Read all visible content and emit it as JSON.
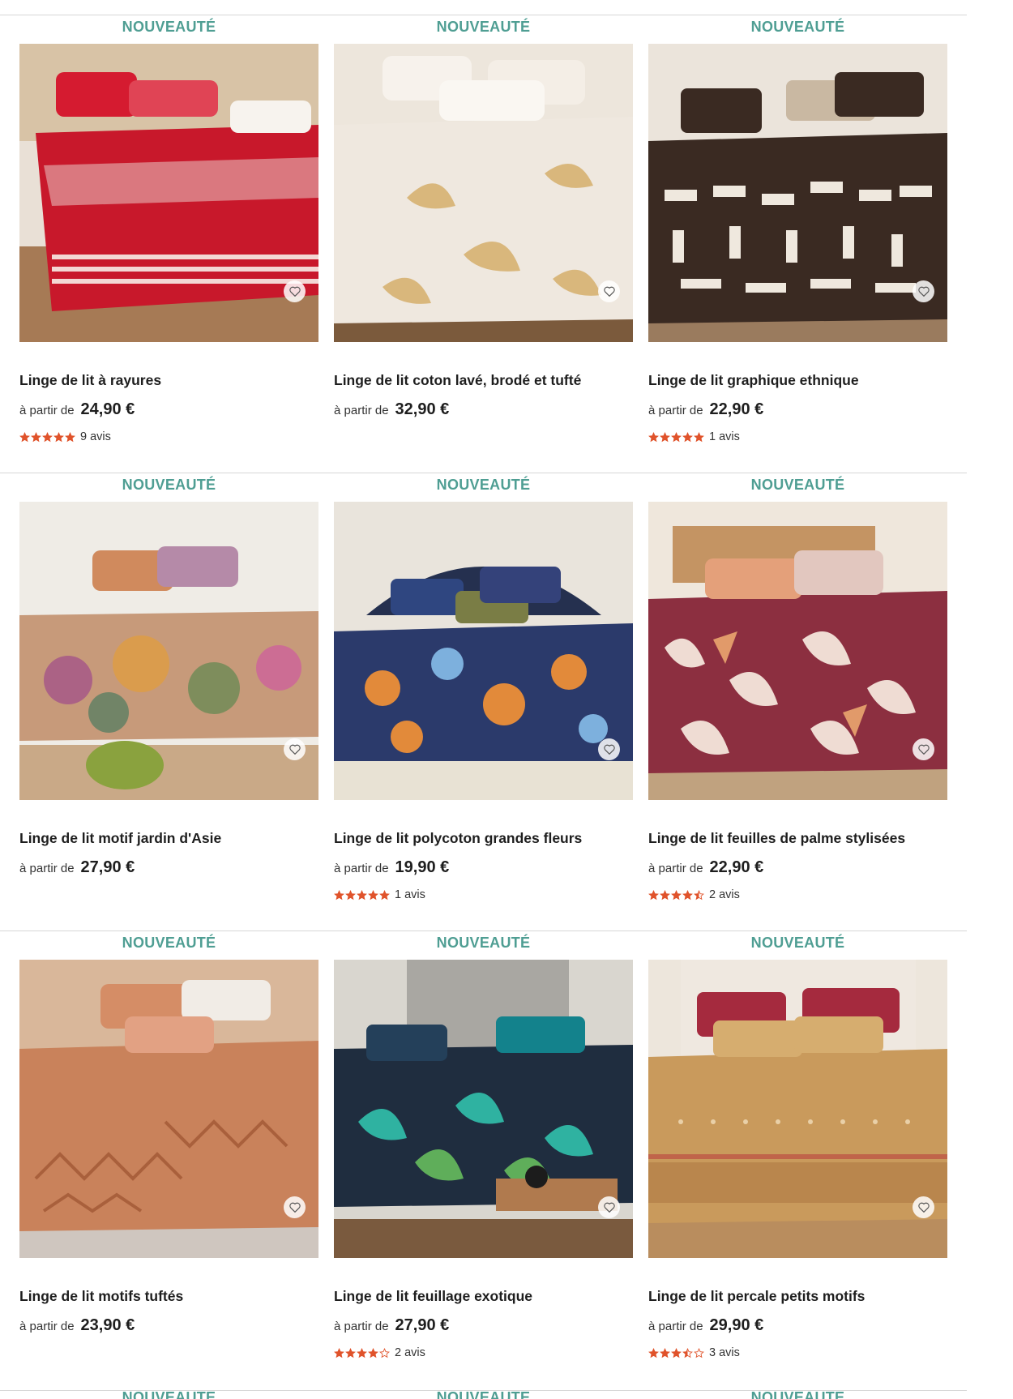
{
  "badge_text": "NOUVEAUTÉ",
  "colors": {
    "badge": "#4f9e93",
    "star": "#e0532b"
  },
  "products": [
    {
      "title": "Linge de lit à rayures",
      "from_label": "à partir de",
      "price": "24,90 €",
      "rating": 5,
      "reviews": "9 avis"
    },
    {
      "title": "Linge de lit coton lavé, brodé et tufté",
      "from_label": "à partir de",
      "price": "32,90 €",
      "rating": null,
      "reviews": ""
    },
    {
      "title": "Linge de lit graphique ethnique",
      "from_label": "à partir de",
      "price": "22,90 €",
      "rating": 5,
      "reviews": "1 avis"
    },
    {
      "title": "Linge de lit motif jardin d'Asie",
      "from_label": "à partir de",
      "price": "27,90 €",
      "rating": null,
      "reviews": ""
    },
    {
      "title": "Linge de lit polycoton grandes fleurs",
      "from_label": "à partir de",
      "price": "19,90 €",
      "rating": 5,
      "reviews": "1 avis"
    },
    {
      "title": "Linge de lit feuilles de palme stylisées",
      "from_label": "à partir de",
      "price": "22,90 €",
      "rating": 4.5,
      "reviews": "2 avis"
    },
    {
      "title": "Linge de lit motifs tuftés",
      "from_label": "à partir de",
      "price": "23,90 €",
      "rating": null,
      "reviews": ""
    },
    {
      "title": "Linge de lit feuillage exotique",
      "from_label": "à partir de",
      "price": "27,90 €",
      "rating": 4,
      "reviews": "2 avis"
    },
    {
      "title": "Linge de lit percale petits motifs",
      "from_label": "à partir de",
      "price": "29,90 €",
      "rating": 3.5,
      "reviews": "3 avis"
    }
  ],
  "icons": {
    "favorite": "heart-icon",
    "rating": "star-icon"
  }
}
